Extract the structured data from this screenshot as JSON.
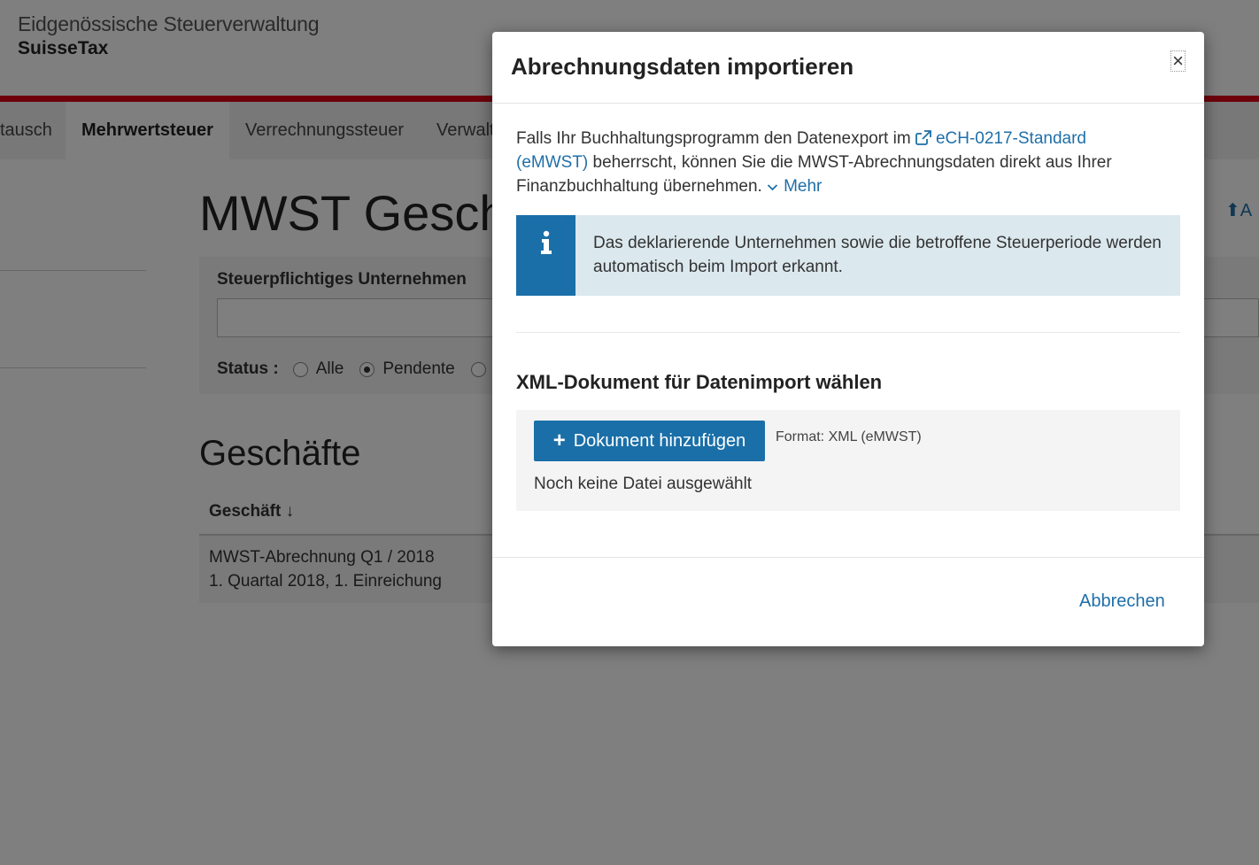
{
  "header": {
    "org_name": "Eidgenössische Steuerverwaltung",
    "app_name": "SuisseTax"
  },
  "nav": {
    "tabs": [
      {
        "label": "tausch",
        "active": false
      },
      {
        "label": "Mehrwertsteuer",
        "active": true
      },
      {
        "label": "Verrechnungssteuer",
        "active": false
      },
      {
        "label": "Verwalt",
        "active": false
      }
    ]
  },
  "page": {
    "title": "MWST Geschä",
    "upload_link": "A",
    "filter": {
      "label": "Steuerpflichtiges Unternehmen",
      "status_label": "Status :",
      "status_options": [
        {
          "label": "Alle",
          "checked": false
        },
        {
          "label": "Pendente",
          "checked": true
        }
      ]
    },
    "section_title": "Geschäfte",
    "table": {
      "column_header": "Geschäft",
      "rows": [
        {
          "title": "MWST-Abrechnung Q1 / 2018",
          "subtitle": "1. Quartal 2018, 1. Einreichung"
        }
      ]
    }
  },
  "modal": {
    "title": "Abrechnungsdaten importieren",
    "close_label": "×",
    "intro_before_link": "Falls Ihr Buchhaltungsprogramm den Datenexport im ",
    "intro_link": "eCH-0217-Standard (eMWST)",
    "intro_after_link": " beherrscht, können Sie die MWST-Abrechnungsdaten direkt aus Ihrer Finanzbuchhaltung übernehmen. ",
    "more_label": "Mehr",
    "info_text": "Das deklarierende Unternehmen sowie die betroffene Steuerperiode werden automatisch beim Import erkannt.",
    "doc_heading": "XML-Dokument für Datenimport wählen",
    "add_button": "Dokument hinzufügen",
    "format_text": "Format: XML (eMWST)",
    "no_file_text": "Noch keine Datei ausgewählt",
    "cancel_button": "Abbrechen"
  },
  "colors": {
    "accent": "#1a6fa8",
    "brand_red": "#dc0018",
    "info_bg": "#dbe8ee"
  }
}
